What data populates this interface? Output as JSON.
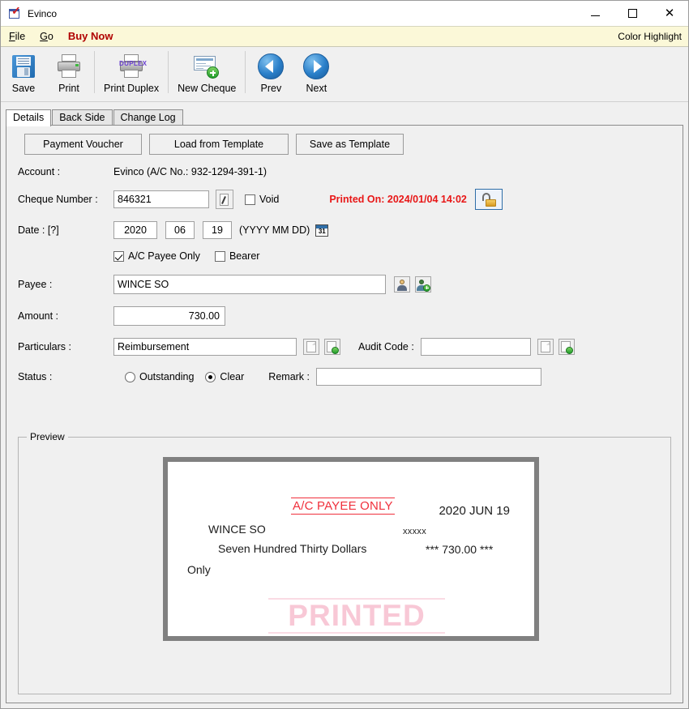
{
  "window": {
    "title": "Evinco",
    "icon": "cheque-app-icon",
    "controls": {
      "minimize": "minimize-icon",
      "maximize": "maximize-icon",
      "close": "close-icon"
    }
  },
  "menu": {
    "items": [
      {
        "label": "File",
        "name": "menu-file"
      },
      {
        "label": "Go",
        "name": "menu-go"
      },
      {
        "label": "Buy Now",
        "name": "menu-buy-now"
      }
    ],
    "right_label": "Color Highlight"
  },
  "toolbar": {
    "buttons": [
      {
        "label": "Save",
        "icon": "floppy-disk-icon"
      },
      {
        "label": "Print",
        "icon": "printer-icon"
      },
      {
        "label": "Print Duplex",
        "icon": "printer-duplex-icon"
      },
      {
        "label": "New Cheque",
        "icon": "new-cheque-icon"
      },
      {
        "label": "Prev",
        "icon": "arrow-left-icon"
      },
      {
        "label": "Next",
        "icon": "arrow-right-icon"
      }
    ]
  },
  "tabs": [
    {
      "label": "Details",
      "active": true
    },
    {
      "label": "Back Side",
      "active": false
    },
    {
      "label": "Change Log",
      "active": false
    }
  ],
  "form": {
    "action_buttons": [
      {
        "label": "Payment Voucher"
      },
      {
        "label": "Load from Template"
      },
      {
        "label": "Save as Template"
      }
    ],
    "account": {
      "label": "Account :",
      "value": "Evinco (A/C No.: 932-1294-391-1)"
    },
    "cheque_number": {
      "label": "Cheque Number :",
      "value": "846321",
      "edit_icon": "pen-edit-icon",
      "void_label": "Void",
      "void_checked": false,
      "printed_on": "Printed On: 2024/01/04 14:02",
      "printed_on_color": "#e81717",
      "lock_icon": "unlock-icon"
    },
    "date": {
      "label": "Date : [?]",
      "year": "2020",
      "month": "06",
      "day": "19",
      "format_hint": "(YYYY MM DD)",
      "calendar_icon": "calendar-icon",
      "calendar_day": "31"
    },
    "crossing": {
      "ac_payee_only_label": "A/C Payee Only",
      "ac_payee_only_checked": true,
      "bearer_label": "Bearer",
      "bearer_checked": false
    },
    "payee": {
      "label": "Payee :",
      "value": "WINCE SO",
      "pick_icon": "user-icon",
      "add_icon": "user-add-icon"
    },
    "amount": {
      "label": "Amount :",
      "value": "730.00"
    },
    "particulars": {
      "label": "Particulars :",
      "value": "Reimbursement",
      "pick_icon": "document-icon",
      "add_icon": "document-add-icon"
    },
    "audit_code": {
      "label": "Audit Code :",
      "value": "",
      "pick_icon": "document-icon",
      "add_icon": "document-add-icon"
    },
    "status": {
      "label": "Status :",
      "options": [
        {
          "label": "Outstanding",
          "selected": false
        },
        {
          "label": "Clear",
          "selected": true
        }
      ]
    },
    "remark": {
      "label": "Remark :",
      "value": ""
    }
  },
  "preview": {
    "group_title": "Preview",
    "cheque": {
      "crossing_text": "A/C PAYEE ONLY",
      "crossing_color": "#f0303c",
      "date_text": "2020 JUN 19",
      "payee_text": "WINCE SO",
      "masked_text": "xxxxx",
      "amount_words_line1": "Seven Hundred Thirty Dollars",
      "amount_words_line2": "Only",
      "amount_number": "*** 730.00 ***",
      "stamp_text": "PRINTED",
      "stamp_color": "#f8c8d6"
    }
  }
}
